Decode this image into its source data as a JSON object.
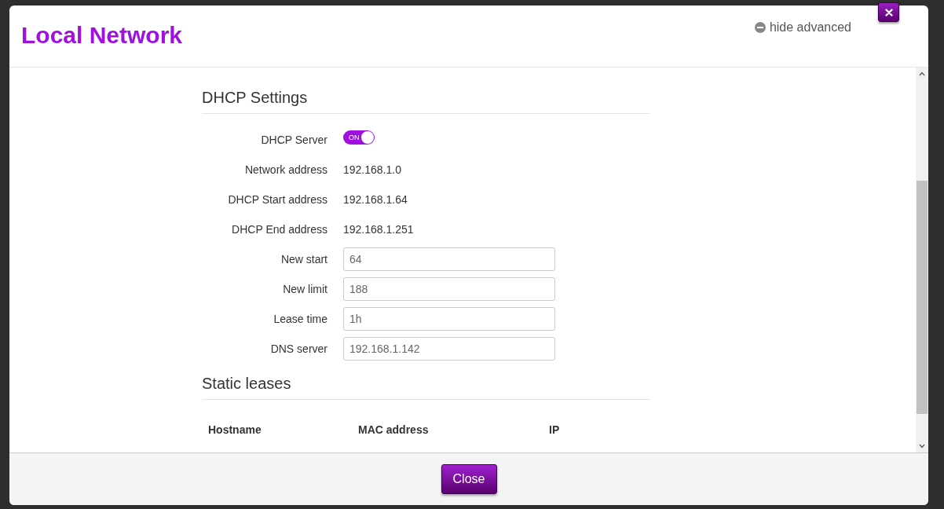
{
  "dialog": {
    "title": "Local Network",
    "advanced_toggle": "hide advanced"
  },
  "dhcp": {
    "heading": "DHCP Settings",
    "rows": [
      {
        "kind": "toggle",
        "label": "DHCP Server",
        "on": true,
        "text": "ON"
      },
      {
        "kind": "text",
        "label": "Network address",
        "value": "192.168.1.0"
      },
      {
        "kind": "text",
        "label": "DHCP Start address",
        "value": "192.168.1.64"
      },
      {
        "kind": "text",
        "label": "DHCP End address",
        "value": "192.168.1.251"
      },
      {
        "kind": "input",
        "label": "New start",
        "value": "64"
      },
      {
        "kind": "input",
        "label": "New limit",
        "value": "188"
      },
      {
        "kind": "input",
        "label": "Lease time",
        "value": "1h"
      },
      {
        "kind": "input",
        "label": "DNS server",
        "value": "192.168.1.142"
      }
    ]
  },
  "static_leases": {
    "heading": "Static leases",
    "columns": [
      "Hostname",
      "MAC address",
      "IP"
    ]
  },
  "footer": {
    "close_button": "Close"
  }
}
